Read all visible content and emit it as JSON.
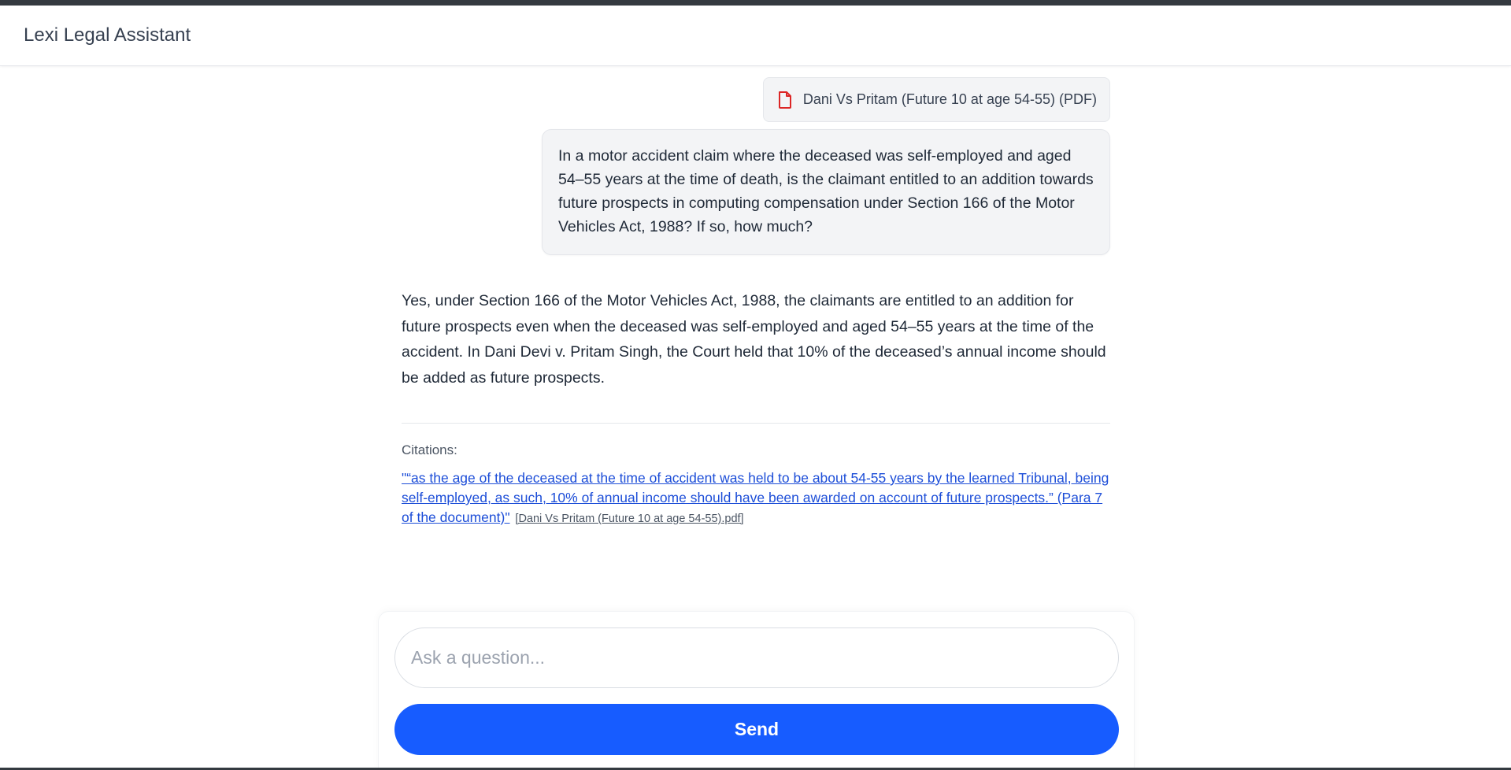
{
  "header": {
    "title": "Lexi Legal Assistant"
  },
  "conversation": {
    "attachment": {
      "label": "Dani Vs Pritam (Future 10 at age 54-55) (PDF)",
      "icon": "pdf-file-icon",
      "icon_color": "#dc2626"
    },
    "user_message": "In a motor accident claim where the deceased was self-employed and aged 54–55 years at the time of death, is the claimant entitled to an addition towards future prospects in computing compensation under Section 166 of the Motor Vehicles Act, 1988? If so, how much?",
    "assistant_message": "Yes, under Section 166 of the Motor Vehicles Act, 1988, the claimants are entitled to an addition for future prospects even when the deceased was self-employed and aged 54–55 years at the time of the accident. In Dani Devi v. Pritam Singh, the Court held that 10% of the deceased’s annual income should be added as future prospects.",
    "citations_label": "Citations:",
    "citations": [
      {
        "quote": "\"“as the age of the deceased at the time of accident was held to be about 54-55 years by the learned Tribunal, being self-employed, as such, 10% of annual income should have been awarded on account of future prospects.” (Para 7 of the document)\"",
        "source": "[Dani Vs Pritam (Future 10 at age 54-55).pdf]"
      }
    ]
  },
  "composer": {
    "placeholder": "Ask a question...",
    "value": "",
    "send_label": "Send"
  },
  "colors": {
    "accent": "#175cff",
    "link": "#1d4ed8",
    "bubble_bg": "#f3f4f6"
  }
}
